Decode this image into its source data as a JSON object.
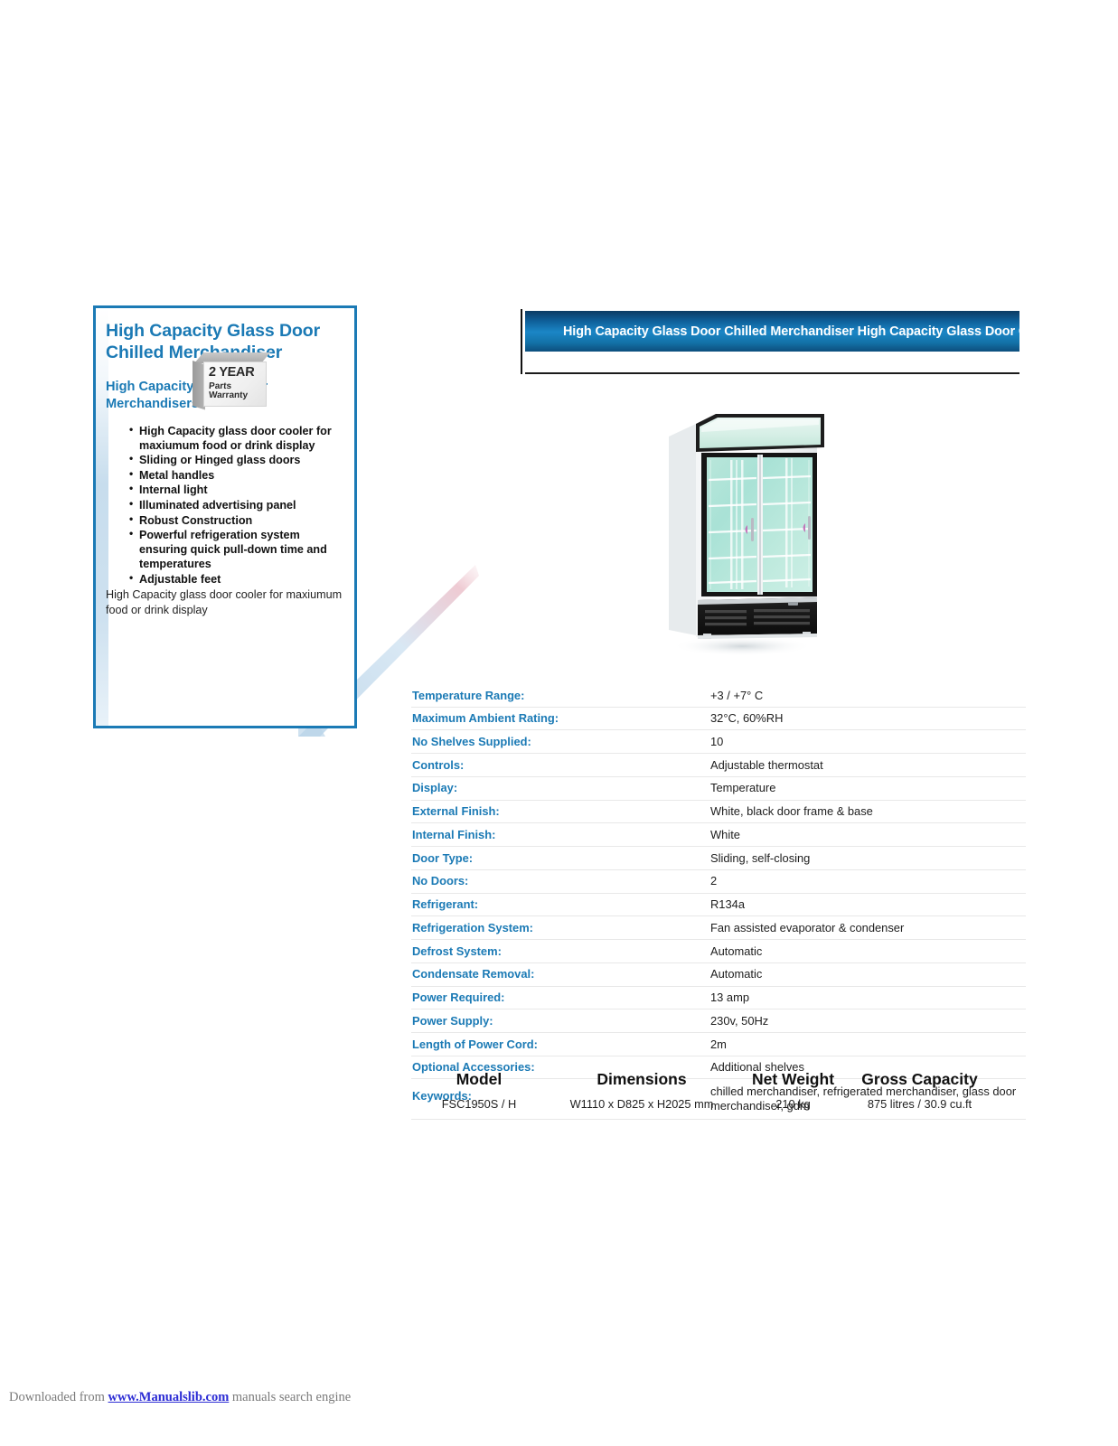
{
  "left_panel": {
    "title": "High Capacity Glass Door Chilled Merchandiser",
    "subtitle": "High Capacity Glass Door Merchandisers",
    "features": [
      "High Capacity glass door cooler for maxiumum food or drink display",
      "Sliding or Hinged glass doors",
      "Metal handles",
      "Internal light",
      "Illuminated advertising panel",
      "Robust Construction",
      "Powerful refrigeration system ensuring quick pull-down time and temperatures",
      "Adjustable feet"
    ],
    "tagline": "High Capacity glass door cooler for maxiumum food or drink display",
    "warranty_badge": {
      "line1": "2 YEAR",
      "line2": "Parts",
      "line3": "Warranty"
    }
  },
  "banner": {
    "text": "High Capacity Glass Door Chilled Merchandiser   High Capacity Glass Door Chilled Merchandiser"
  },
  "product_image": {
    "alt": "High Capacity Glass Door Chilled Merchandiser two-door upright display cooler"
  },
  "specifications": [
    {
      "label": "Temperature Range:",
      "value": "+3 / +7° C"
    },
    {
      "label": "Maximum Ambient Rating:",
      "value": "32°C, 60%RH"
    },
    {
      "label": "No Shelves Supplied:",
      "value": "10"
    },
    {
      "label": "Controls:",
      "value": "Adjustable thermostat"
    },
    {
      "label": "Display:",
      "value": "Temperature"
    },
    {
      "label": "External Finish:",
      "value": "White, black door frame & base"
    },
    {
      "label": "Internal Finish:",
      "value": "White"
    },
    {
      "label": "Door Type:",
      "value": "Sliding, self-closing"
    },
    {
      "label": "No Doors:",
      "value": "2"
    },
    {
      "label": "Refrigerant:",
      "value": "R134a"
    },
    {
      "label": "Refrigeration System:",
      "value": "Fan assisted evaporator & condenser"
    },
    {
      "label": "Defrost System:",
      "value": "Automatic"
    },
    {
      "label": "Condensate Removal:",
      "value": "Automatic"
    },
    {
      "label": "Power Required:",
      "value": "13 amp"
    },
    {
      "label": "Power Supply:",
      "value": "230v, 50Hz"
    },
    {
      "label": "Length of Power Cord:",
      "value": "2m"
    },
    {
      "label": "Optional Accessories:",
      "value": "Additional shelves"
    }
  ],
  "keywords_row": {
    "label": "Keywords:",
    "value": "chilled merchandiser, refrigerated merchandiser, glass door merchandiser, gdm"
  },
  "model_table": {
    "headers": [
      "Model",
      "Dimensions",
      "Net Weight",
      "Gross Capacity"
    ],
    "rows": [
      [
        "FSC1950S / H",
        "W1110 x D825 x H2025 mm",
        "210 kg",
        "875 litres / 30.9 cu.ft"
      ]
    ]
  },
  "footer": {
    "prefix": "Downloaded from ",
    "link": "www.Manualslib.com",
    "suffix": " manuals search engine"
  },
  "colors": {
    "accent_blue": "#1b7ab5",
    "banner_blue": "#1b86c6",
    "banner_dark": "#0c3b63",
    "rule_gray": "#e8e8e8",
    "link_blue": "#2b2bd4"
  }
}
